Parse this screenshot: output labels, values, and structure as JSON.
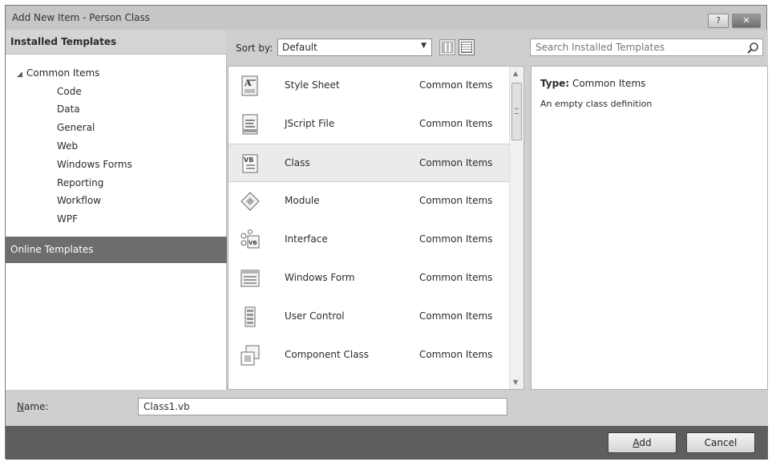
{
  "window": {
    "title": "Add New Item - Person Class",
    "help_label": "?",
    "close_label": "✕"
  },
  "left": {
    "installed_header": "Installed Templates",
    "tree_root": "Common Items",
    "tree_children": [
      "Code",
      "Data",
      "General",
      "Web",
      "Windows Forms",
      "Reporting",
      "Workflow",
      "WPF"
    ],
    "online_templates": "Online Templates"
  },
  "sort": {
    "label": "Sort by:",
    "value": "Default"
  },
  "items": [
    {
      "name": "Style Sheet",
      "category": "Common Items",
      "icon": "style-sheet-icon"
    },
    {
      "name": "JScript File",
      "category": "Common Items",
      "icon": "jscript-file-icon"
    },
    {
      "name": "Class",
      "category": "Common Items",
      "icon": "vb-class-icon",
      "selected": true
    },
    {
      "name": "Module",
      "category": "Common Items",
      "icon": "module-icon"
    },
    {
      "name": "Interface",
      "category": "Common Items",
      "icon": "interface-icon"
    },
    {
      "name": "Windows Form",
      "category": "Common Items",
      "icon": "windows-form-icon"
    },
    {
      "name": "User Control",
      "category": "Common Items",
      "icon": "user-control-icon"
    },
    {
      "name": "Component Class",
      "category": "Common Items",
      "icon": "component-class-icon"
    }
  ],
  "search": {
    "placeholder": "Search Installed Templates"
  },
  "details": {
    "type_label": "Type:",
    "type_value": "Common Items",
    "description": "An empty class definition"
  },
  "name_field": {
    "label_underlined": "N",
    "label_rest": "ame:",
    "value": "Class1.vb"
  },
  "buttons": {
    "add_underlined": "A",
    "add_rest": "dd",
    "cancel": "Cancel"
  }
}
